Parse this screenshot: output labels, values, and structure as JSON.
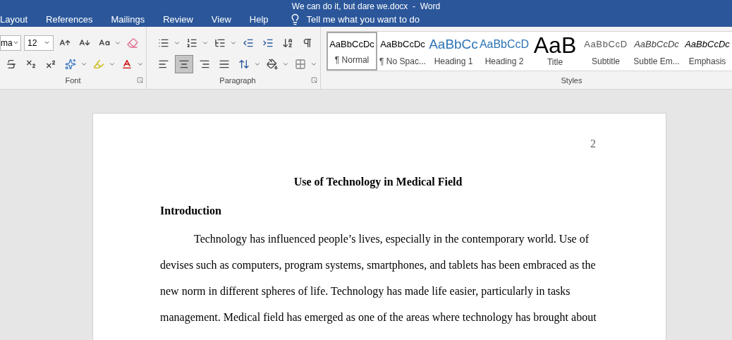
{
  "window": {
    "title": "We can do it, but dare we.docx  -  Word"
  },
  "tabs": [
    {
      "label": "Layout",
      "selected": false
    },
    {
      "label": "References",
      "selected": false
    },
    {
      "label": "Mailings",
      "selected": false
    },
    {
      "label": "Review",
      "selected": false
    },
    {
      "label": "View",
      "selected": false
    },
    {
      "label": "Help",
      "selected": false
    }
  ],
  "tell_me": {
    "placeholder": "Tell me what you want to do"
  },
  "font_group": {
    "font_name": "ma",
    "font_size": "12",
    "label": "Font"
  },
  "paragraph_group": {
    "label": "Paragraph",
    "align_center_selected": true
  },
  "styles_group": {
    "label": "Styles",
    "items": [
      {
        "preview": "AaBbCcDc",
        "name": "¶ Normal",
        "kind": "normal",
        "selected": true
      },
      {
        "preview": "AaBbCcDc",
        "name": "¶ No Spac...",
        "kind": "normal",
        "selected": false
      },
      {
        "preview": "AaBbCc",
        "name": "Heading 1",
        "kind": "heading1",
        "selected": false
      },
      {
        "preview": "AaBbCcD",
        "name": "Heading 2",
        "kind": "heading2",
        "selected": false
      },
      {
        "preview": "AaB",
        "name": "Title",
        "kind": "title",
        "selected": false
      },
      {
        "preview": "AaBbCcD",
        "name": "Subtitle",
        "kind": "subtitle",
        "selected": false
      },
      {
        "preview": "AaBbCcDc",
        "name": "Subtle Em...",
        "kind": "subtle",
        "selected": false
      },
      {
        "preview": "AaBbCcDc",
        "name": "Emphasis",
        "kind": "emphasis",
        "selected": false
      }
    ]
  },
  "document": {
    "page_number": "2",
    "title": "Use of Technology in Medical Field",
    "heading": "Introduction",
    "paragraph": "Technology has influenced people’s lives, especially in the contemporary world. Use of devises such as computers, program systems, smartphones, and tablets has been embraced as the new norm in different spheres of life. Technology has made life easier, particularly in tasks management. Medical field has emerged as one of the areas where technology has brought about"
  }
}
